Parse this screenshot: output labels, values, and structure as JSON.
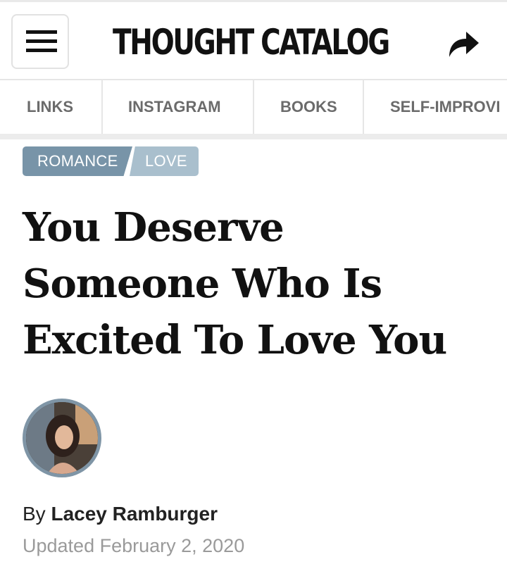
{
  "header": {
    "logo_text": "THOUGHT CATALOG",
    "menu_icon": "hamburger-menu-icon",
    "share_icon": "share-arrow-icon"
  },
  "nav": {
    "items": [
      {
        "label": "LINKS"
      },
      {
        "label": "INSTAGRAM"
      },
      {
        "label": "BOOKS"
      },
      {
        "label": "SELF-IMPROVI"
      }
    ]
  },
  "article": {
    "tags": [
      {
        "label": "ROMANCE"
      },
      {
        "label": "LOVE"
      }
    ],
    "title": "You Deserve Someone Who Is Excited To Love You",
    "byline_prefix": "By ",
    "author": "Lacey Ramburger",
    "updated": "Updated February 2, 2020"
  },
  "colors": {
    "tag_primary": "#7894a8",
    "tag_secondary": "#a9bfcd",
    "avatar_ring": "#7f95a6",
    "meta_gray": "#9a9a9a"
  }
}
